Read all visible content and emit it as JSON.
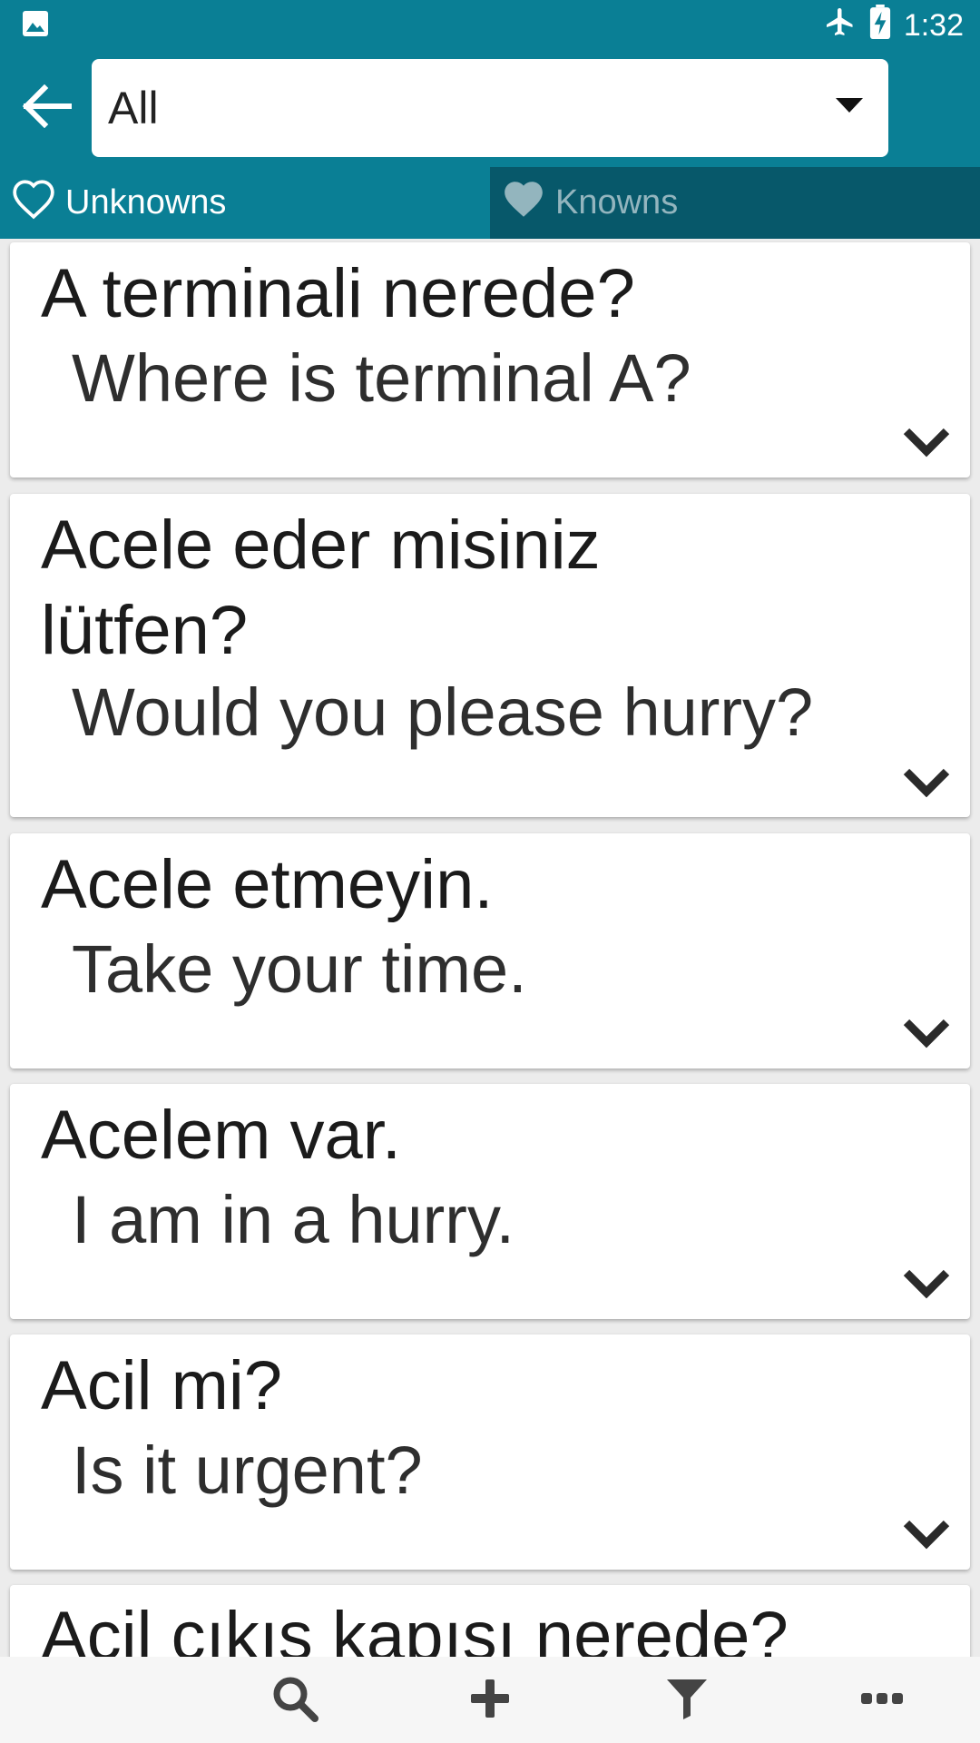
{
  "status_bar": {
    "time": "1:32",
    "icons": [
      "image-icon",
      "airplane-mode-icon",
      "battery-charging-icon"
    ]
  },
  "header": {
    "category_select": {
      "value": "All"
    }
  },
  "tabs": [
    {
      "label": "Unknowns",
      "icon": "heart-outline-icon",
      "active": true
    },
    {
      "label": "Knowns",
      "icon": "heart-filled-icon",
      "active": false
    }
  ],
  "phrases": [
    {
      "turkish": "A terminali nerede?",
      "english": "Where is terminal A?"
    },
    {
      "turkish": "Acele eder misiniz lütfen?",
      "english": "Would you please hurry?"
    },
    {
      "turkish": "Acele etmeyin.",
      "english": "Take your time."
    },
    {
      "turkish": "Acelem var.",
      "english": "I am in a hurry."
    },
    {
      "turkish": "Acil mi?",
      "english": "Is it urgent?"
    },
    {
      "turkish": "Acil çıkış kapısı nerede?",
      "english": ""
    }
  ],
  "bottom_bar": {
    "actions": [
      "search-icon",
      "add-icon",
      "filter-icon",
      "more-icon"
    ]
  },
  "colors": {
    "primary": "#0a7f95",
    "tab_inactive": "#07586a",
    "card_background": "#ffffff",
    "list_background": "#ececec"
  }
}
